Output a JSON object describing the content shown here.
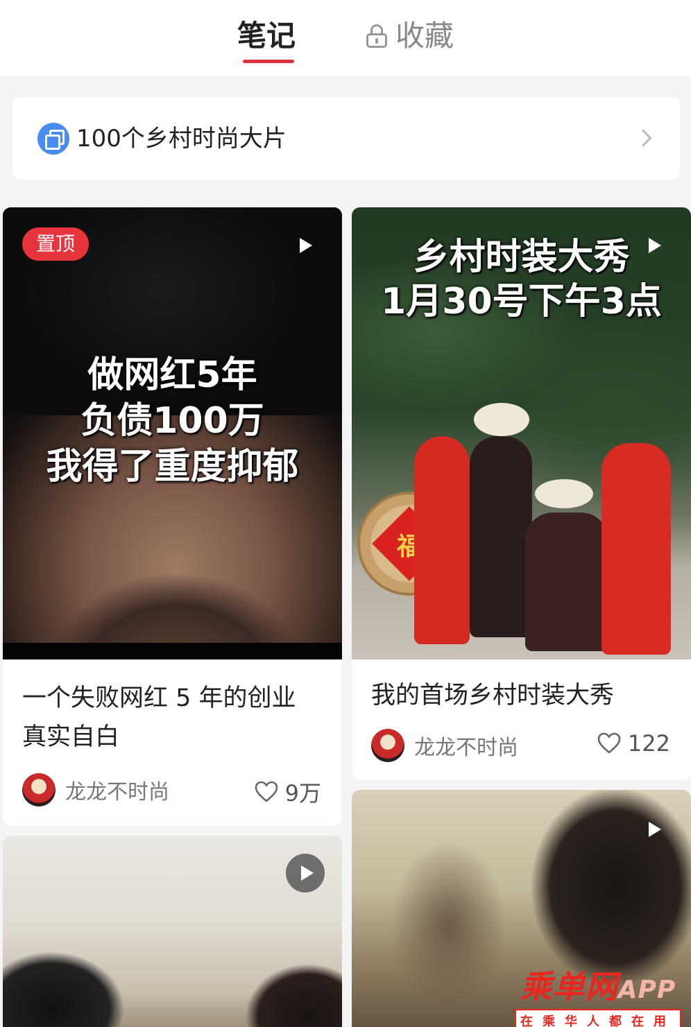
{
  "tabs": {
    "notes_label": "笔记",
    "favorites_label": "收藏",
    "active": "笔记"
  },
  "collection": {
    "title": "100个乡村时尚大片"
  },
  "cards": [
    {
      "badge": "置顶",
      "overlay_lines": [
        "做网红5年",
        "负债100万",
        "我得了重度抑郁"
      ],
      "title_line1": "一个失败网红 5 年的创业",
      "title_line2": "真实自白",
      "author": "龙龙不时尚",
      "likes": "9万"
    },
    {
      "overlay_lines": [
        "乡村时装大秀",
        "1月30号下午3点"
      ],
      "fu": "福",
      "title_line1": "我的首场乡村时装大秀",
      "author": "龙龙不时尚",
      "likes": "122"
    }
  ],
  "watermark": {
    "main": "乘单网",
    "app": "APP",
    "sub": "在乘华人都在用"
  },
  "colors": {
    "accent": "#e0303f",
    "badge": "#e8343d",
    "collection_icon": "#4a8bf0"
  }
}
